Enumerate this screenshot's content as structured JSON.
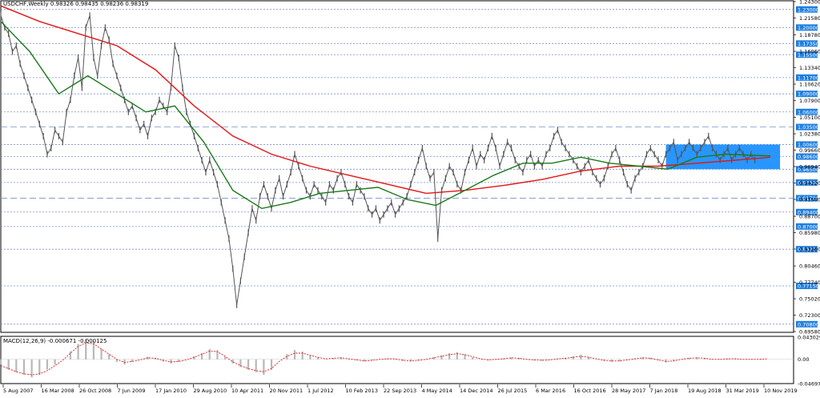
{
  "header": {
    "symbol": "USDCHF,Weekly",
    "ohlc": "0.98326 0.98435 0.98236 0.98319"
  },
  "macd_header": {
    "label": "MACD(12,26,9) -0.000671 -0.000125"
  },
  "colors": {
    "price": "#555555",
    "ma_red": "#e31515",
    "ma_green": "#1a7a1a",
    "hline": "#7a8fd0",
    "rect": "#1e90ff",
    "label_bg": "#1e7fe0",
    "macd_hist": "#b8b8b8",
    "macd_signal": "#e31515"
  },
  "chart_data": [
    {
      "type": "line",
      "name": "price",
      "x_ticks": [
        "5 Aug 2007",
        "16 Mar 2008",
        "26 Oct 2008",
        "7 Jun 2009",
        "17 Jan 2010",
        "29 Aug 2010",
        "10 Apr 2011",
        "20 Nov 2011",
        "1 Jul 2012",
        "10 Feb 2013",
        "22 Sep 2013",
        "4 May 2014",
        "14 Dec 2014",
        "26 Jul 2015",
        "6 Mar 2016",
        "16 Oct 2016",
        "28 May 2017",
        "7 Jan 2018",
        "19 Aug 2018",
        "31 Mar 2019",
        "10 Nov 2019"
      ],
      "y_ticks": [
        "1.24300",
        "1.21580",
        "1.18780",
        "1.16060",
        "1.13340",
        "1.10620",
        "1.07900",
        "1.05100",
        "1.02380",
        "0.99660",
        "0.96940",
        "0.94220",
        "0.91500",
        "0.88700",
        "0.85980",
        "0.83260",
        "0.80460",
        "0.77740",
        "0.75020",
        "0.72300",
        "0.69580"
      ],
      "ylim": [
        0.6958,
        1.243
      ],
      "x": [
        0,
        4,
        8,
        12,
        16,
        20,
        24,
        28,
        32,
        36,
        40,
        44,
        48,
        52,
        56,
        60,
        64,
        68,
        72,
        76,
        80,
        84,
        88,
        92,
        96,
        100,
        104,
        108,
        112,
        116,
        120,
        124,
        128,
        132,
        136,
        140,
        144,
        148,
        152,
        156,
        160,
        164,
        168,
        172,
        176,
        180,
        184,
        188,
        192,
        196,
        200,
        204,
        208,
        212,
        216,
        220,
        224,
        228,
        232,
        236,
        240,
        244,
        248,
        252,
        256,
        260,
        264,
        268,
        272,
        276,
        280,
        284,
        288,
        292,
        296,
        300,
        304,
        308,
        312,
        316,
        320,
        324,
        328,
        332,
        336,
        340,
        344,
        348,
        352,
        356,
        360,
        364,
        368,
        372,
        376,
        380,
        384,
        388,
        392,
        396,
        400,
        404,
        408,
        412,
        416,
        420,
        424,
        428,
        432,
        436,
        440,
        444,
        448,
        452,
        456,
        460,
        464,
        468,
        472,
        476,
        480,
        484,
        488,
        492,
        496,
        500,
        504,
        508,
        512,
        516,
        520,
        524,
        528,
        532,
        536,
        540,
        544,
        548,
        552,
        556,
        560,
        564,
        568,
        572,
        576,
        580,
        584,
        588,
        592,
        596,
        600,
        604,
        608,
        612,
        616,
        620,
        624,
        628,
        632,
        636,
        640,
        644,
        648,
        652,
        656,
        660,
        664,
        668,
        672,
        676,
        680,
        684,
        688,
        692,
        696,
        700,
        704,
        708,
        712,
        716,
        720,
        724,
        728,
        732,
        736,
        740,
        744,
        748,
        752,
        756,
        760,
        764,
        768,
        772,
        776,
        780,
        784,
        788,
        792,
        796
      ],
      "y": [
        1.22,
        1.2,
        1.19,
        1.16,
        1.17,
        1.14,
        1.12,
        1.1,
        1.08,
        1.06,
        1.04,
        1.02,
        0.99,
        1.0,
        1.03,
        1.02,
        1.01,
        1.06,
        1.08,
        1.12,
        1.15,
        1.1,
        1.2,
        1.22,
        1.15,
        1.12,
        1.17,
        1.2,
        1.18,
        1.14,
        1.12,
        1.1,
        1.08,
        1.06,
        1.07,
        1.05,
        1.03,
        1.04,
        1.02,
        1.05,
        1.06,
        1.08,
        1.07,
        1.06,
        1.1,
        1.17,
        1.15,
        1.1,
        1.06,
        1.04,
        1.02,
        1.0,
        0.98,
        0.96,
        0.98,
        0.96,
        0.94,
        0.91,
        0.88,
        0.85,
        0.8,
        0.74,
        0.78,
        0.82,
        0.86,
        0.9,
        0.88,
        0.92,
        0.94,
        0.92,
        0.9,
        0.93,
        0.95,
        0.92,
        0.94,
        0.96,
        0.99,
        0.97,
        0.95,
        0.93,
        0.92,
        0.94,
        0.93,
        0.92,
        0.91,
        0.94,
        0.93,
        0.95,
        0.96,
        0.94,
        0.92,
        0.91,
        0.94,
        0.93,
        0.92,
        0.9,
        0.89,
        0.9,
        0.88,
        0.89,
        0.9,
        0.91,
        0.89,
        0.9,
        0.91,
        0.92,
        0.94,
        0.96,
        0.98,
        1.0,
        0.97,
        0.95,
        0.96,
        0.85,
        0.93,
        0.95,
        0.97,
        0.96,
        0.94,
        0.93,
        0.96,
        0.98,
        1.0,
        0.97,
        0.99,
        0.98,
        1.0,
        1.02,
        1.0,
        0.97,
        0.99,
        1.01,
        1.0,
        0.98,
        0.97,
        0.96,
        0.98,
        0.99,
        0.97,
        0.98,
        0.97,
        0.99,
        1.0,
        1.02,
        1.03,
        1.01,
        1.0,
        0.99,
        0.98,
        0.97,
        0.96,
        0.97,
        0.98,
        0.96,
        0.95,
        0.94,
        0.95,
        0.97,
        0.99,
        1.0,
        0.98,
        0.96,
        0.94,
        0.93,
        0.95,
        0.96,
        0.97,
        0.99,
        1.0,
        0.99,
        0.98,
        0.97,
        0.99,
        1.0,
        1.01,
        0.98,
        0.99,
        1.0,
        1.01,
        1.0,
        0.99,
        1.0,
        1.01,
        1.02,
        1.0,
        0.99,
        0.98,
        0.99,
        1.0,
        0.98,
        0.99,
        1.0,
        0.99,
        0.98,
        0.99,
        0.98
      ]
    },
    {
      "type": "line",
      "name": "ma_red",
      "x": [
        0,
        40,
        80,
        120,
        160,
        200,
        240,
        280,
        320,
        360,
        400,
        440,
        480,
        520,
        560,
        600,
        640,
        680,
        720,
        760,
        796
      ],
      "y": [
        1.236,
        1.21,
        1.19,
        1.17,
        1.13,
        1.07,
        1.02,
        0.99,
        0.97,
        0.955,
        0.94,
        0.925,
        0.93,
        0.938,
        0.948,
        0.962,
        0.97,
        0.97,
        0.975,
        0.98,
        0.985
      ]
    },
    {
      "type": "line",
      "name": "ma_green",
      "x": [
        0,
        30,
        60,
        90,
        120,
        150,
        180,
        210,
        240,
        270,
        300,
        330,
        360,
        390,
        420,
        450,
        480,
        510,
        540,
        570,
        600,
        630,
        660,
        690,
        720,
        750,
        780,
        796
      ],
      "y": [
        1.21,
        1.16,
        1.09,
        1.12,
        1.09,
        1.06,
        1.07,
        1.01,
        0.93,
        0.9,
        0.91,
        0.925,
        0.93,
        0.935,
        0.915,
        0.905,
        0.93,
        0.955,
        0.975,
        0.975,
        0.985,
        0.975,
        0.97,
        0.965,
        0.985,
        0.99,
        0.988,
        0.987
      ]
    },
    {
      "type": "bar",
      "name": "MACD",
      "ylim": [
        -0.046971,
        0.043029
      ],
      "y_ticks": [
        "0.043029",
        "0.00",
        "-0.046971"
      ],
      "x": [
        0,
        8,
        16,
        24,
        32,
        40,
        48,
        56,
        64,
        72,
        80,
        88,
        96,
        104,
        112,
        120,
        128,
        136,
        144,
        152,
        160,
        168,
        176,
        184,
        192,
        200,
        208,
        216,
        224,
        232,
        240,
        248,
        256,
        264,
        272,
        280,
        288,
        296,
        304,
        312,
        320,
        328,
        336,
        344,
        352,
        360,
        368,
        376,
        384,
        392,
        400,
        408,
        416,
        424,
        432,
        440,
        448,
        456,
        464,
        472,
        480,
        488,
        496,
        504,
        512,
        520,
        528,
        536,
        544,
        552,
        560,
        568,
        576,
        584,
        592,
        600,
        608,
        616,
        624,
        632,
        640,
        648,
        656,
        664,
        672,
        680,
        688,
        696,
        704,
        712,
        720,
        728,
        736,
        744,
        752,
        760,
        768,
        776,
        784,
        792
      ],
      "values": [
        -0.01,
        -0.02,
        -0.025,
        -0.03,
        -0.035,
        -0.03,
        -0.02,
        -0.01,
        0.0,
        0.015,
        0.03,
        0.04,
        0.035,
        0.02,
        0.01,
        -0.005,
        -0.01,
        -0.005,
        0.0,
        0.005,
        0.002,
        -0.004,
        -0.008,
        -0.005,
        0.0,
        0.006,
        0.012,
        0.02,
        0.018,
        0.005,
        -0.008,
        -0.015,
        -0.02,
        -0.025,
        -0.03,
        -0.02,
        0.0,
        0.01,
        0.018,
        0.015,
        0.008,
        0.004,
        0.0,
        0.002,
        0.004,
        0.001,
        -0.002,
        -0.004,
        -0.002,
        0.0,
        0.002,
        0.001,
        -0.003,
        -0.004,
        -0.002,
        0.0,
        0.004,
        0.008,
        0.012,
        0.014,
        0.01,
        0.004,
        0.0,
        -0.002,
        -0.001,
        0.002,
        0.004,
        0.003,
        0.0,
        -0.002,
        -0.003,
        -0.001,
        0.001,
        0.003,
        0.006,
        0.009,
        0.005,
        0.0,
        -0.003,
        -0.005,
        -0.004,
        -0.001,
        0.002,
        0.004,
        0.003,
        -0.002,
        -0.006,
        -0.004,
        0.0,
        0.003,
        0.004,
        0.002,
        0.0,
        -0.001,
        0.001,
        0.002,
        0.0,
        -0.001,
        0.0,
        0.001
      ],
      "signal": [
        -0.012,
        -0.018,
        -0.024,
        -0.028,
        -0.03,
        -0.028,
        -0.022,
        -0.012,
        -0.002,
        0.012,
        0.025,
        0.032,
        0.03,
        0.02,
        0.01,
        0.0,
        -0.006,
        -0.004,
        -0.001,
        0.003,
        0.002,
        -0.002,
        -0.005,
        -0.004,
        -0.001,
        0.004,
        0.01,
        0.016,
        0.015,
        0.006,
        -0.005,
        -0.012,
        -0.018,
        -0.022,
        -0.024,
        -0.018,
        -0.004,
        0.006,
        0.012,
        0.012,
        0.008,
        0.004,
        0.001,
        0.002,
        0.003,
        0.001,
        -0.001,
        -0.003,
        -0.002,
        0.0,
        0.001,
        0.001,
        -0.002,
        -0.003,
        -0.002,
        0.0,
        0.003,
        0.006,
        0.009,
        0.011,
        0.009,
        0.005,
        0.001,
        -0.001,
        0.0,
        0.001,
        0.003,
        0.002,
        0.0,
        -0.001,
        -0.002,
        -0.001,
        0.001,
        0.002,
        0.004,
        0.006,
        0.004,
        0.001,
        -0.002,
        -0.003,
        -0.003,
        -0.001,
        0.001,
        0.003,
        0.002,
        -0.001,
        -0.004,
        -0.003,
        0.0,
        0.002,
        0.003,
        0.002,
        0.0,
        0.0,
        0.001,
        0.001,
        0.0,
        0.0,
        0.0,
        0.001
      ]
    }
  ],
  "hlevels": [
    {
      "value": 1.23,
      "label": "1.23000",
      "dash": "dot"
    },
    {
      "value": 1.2,
      "label": "1.20000",
      "dash": "dot"
    },
    {
      "value": 1.1735,
      "label": "1.17350",
      "dash": "dot"
    },
    {
      "value": 1.155,
      "label": "1.15500",
      "dash": "dot"
    },
    {
      "value": 1.117,
      "label": "1.11700",
      "dash": "dot"
    },
    {
      "value": 1.09,
      "label": "1.09000",
      "dash": "dot"
    },
    {
      "value": 1.06,
      "label": "1.06000",
      "dash": "dot"
    },
    {
      "value": 1.035,
      "label": "1.03500",
      "dash": "long"
    },
    {
      "value": 1.006,
      "label": "1.00600",
      "dash": "dot"
    },
    {
      "value": 0.986,
      "label": "0.98600",
      "dash": "dot"
    },
    {
      "value": 0.965,
      "label": "0.96500",
      "dash": "dot"
    },
    {
      "value": 0.943,
      "label": "0.94300",
      "dash": "dot"
    },
    {
      "value": 0.917,
      "label": "0.91700",
      "dash": "long"
    },
    {
      "value": 0.894,
      "label": "0.89400",
      "dash": "dot"
    },
    {
      "value": 0.87,
      "label": "0.87000",
      "dash": "dot"
    },
    {
      "value": 0.83237,
      "label": "0.83237",
      "dash": "dot"
    },
    {
      "value": 0.7715,
      "label": "0.77150",
      "dash": "dot"
    },
    {
      "value": 0.708,
      "label": "0.70800",
      "dash": "dot"
    }
  ],
  "range_box": {
    "x0": 688,
    "x1": 806,
    "y0": 1.006,
    "y1": 0.965
  }
}
